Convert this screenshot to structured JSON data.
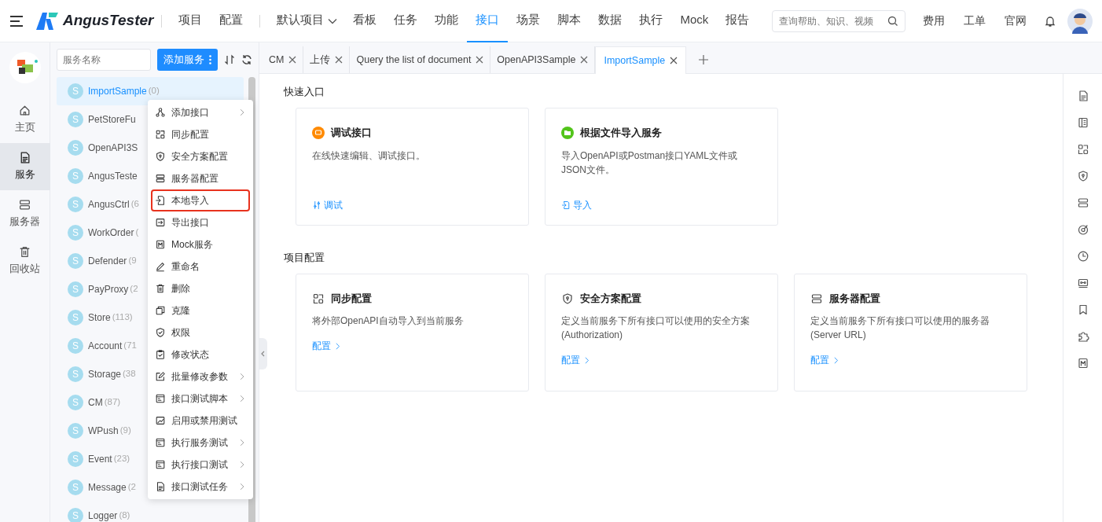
{
  "header": {
    "brand": "AngusTester",
    "nav": [
      {
        "label": "项目",
        "selected": false,
        "dropdown": false,
        "sep_before": false
      },
      {
        "label": "配置",
        "selected": false,
        "dropdown": false,
        "sep_before": false
      },
      {
        "label": "默认项目",
        "selected": false,
        "dropdown": true,
        "sep_before": true
      },
      {
        "label": "看板",
        "selected": false,
        "dropdown": false,
        "sep_before": false
      },
      {
        "label": "任务",
        "selected": false,
        "dropdown": false,
        "sep_before": false
      },
      {
        "label": "功能",
        "selected": false,
        "dropdown": false,
        "sep_before": false
      },
      {
        "label": "接口",
        "selected": true,
        "dropdown": false,
        "sep_before": false
      },
      {
        "label": "场景",
        "selected": false,
        "dropdown": false,
        "sep_before": false
      },
      {
        "label": "脚本",
        "selected": false,
        "dropdown": false,
        "sep_before": false
      },
      {
        "label": "数据",
        "selected": false,
        "dropdown": false,
        "sep_before": false
      },
      {
        "label": "执行",
        "selected": false,
        "dropdown": false,
        "sep_before": false
      },
      {
        "label": "Mock",
        "selected": false,
        "dropdown": false,
        "sep_before": false
      },
      {
        "label": "报告",
        "selected": false,
        "dropdown": false,
        "sep_before": false
      }
    ],
    "search": {
      "placeholder": "查询帮助、知识、视频"
    },
    "links": [
      "费用",
      "工单",
      "官网"
    ]
  },
  "rail": {
    "items": [
      {
        "kind": "home",
        "label": "主页",
        "selected": false
      },
      {
        "kind": "doc",
        "label": "服务",
        "selected": true
      },
      {
        "kind": "server",
        "label": "服务器",
        "selected": false
      },
      {
        "kind": "trash",
        "label": "回收站",
        "selected": false
      }
    ]
  },
  "services": {
    "search": {
      "placeholder": "服务名称"
    },
    "add_button": "添加服务",
    "items": [
      {
        "avatar": "S",
        "name": "ImportSample",
        "count": "(0)",
        "selected": true
      },
      {
        "avatar": "S",
        "name": "PetStoreFu",
        "selected": false
      },
      {
        "avatar": "S",
        "name": "OpenAPI3S",
        "selected": false
      },
      {
        "avatar": "S",
        "name": "AngusTeste",
        "selected": false
      },
      {
        "avatar": "S",
        "name": "AngusCtrl",
        "count": "(6",
        "selected": false
      },
      {
        "avatar": "S",
        "name": "WorkOrder",
        "count": "(",
        "selected": false
      },
      {
        "avatar": "S",
        "name": "Defender",
        "count": "(9",
        "selected": false
      },
      {
        "avatar": "S",
        "name": "PayProxy",
        "count": "(2",
        "selected": false
      },
      {
        "avatar": "S",
        "name": "Store",
        "count": "(113)",
        "selected": false
      },
      {
        "avatar": "S",
        "name": "Account",
        "count": "(71",
        "selected": false
      },
      {
        "avatar": "S",
        "name": "Storage",
        "count": "(38",
        "selected": false
      },
      {
        "avatar": "S",
        "name": "CM",
        "count": "(87)",
        "selected": false
      },
      {
        "avatar": "S",
        "name": "WPush",
        "count": "(9)",
        "selected": false
      },
      {
        "avatar": "S",
        "name": "Event",
        "count": "(23)",
        "selected": false
      },
      {
        "avatar": "S",
        "name": "Message",
        "count": "(2",
        "selected": false
      },
      {
        "avatar": "S",
        "name": "Logger",
        "count": "(8)",
        "selected": false
      }
    ]
  },
  "context_menu": {
    "items": [
      {
        "kind": "nodes",
        "label": "添加接口",
        "submenu": true,
        "highlighted": false
      },
      {
        "kind": "sync",
        "label": "同步配置",
        "submenu": false,
        "highlighted": false
      },
      {
        "kind": "shield",
        "label": "安全方案配置",
        "submenu": false,
        "highlighted": false
      },
      {
        "kind": "server",
        "label": "服务器配置",
        "submenu": false,
        "highlighted": false
      },
      {
        "kind": "import",
        "label": "本地导入",
        "submenu": false,
        "highlighted": true
      },
      {
        "kind": "export",
        "label": "导出接口",
        "submenu": false,
        "highlighted": false
      },
      {
        "kind": "mock",
        "label": "Mock服务",
        "submenu": false,
        "highlighted": false
      },
      {
        "kind": "pencil",
        "label": "重命名",
        "submenu": false,
        "highlighted": false
      },
      {
        "kind": "trash",
        "label": "删除",
        "submenu": false,
        "highlighted": false
      },
      {
        "kind": "copy",
        "label": "克隆",
        "submenu": false,
        "highlighted": false
      },
      {
        "kind": "shieldcheck",
        "label": "权限",
        "submenu": false,
        "highlighted": false
      },
      {
        "kind": "clipboard",
        "label": "修改状态",
        "submenu": false,
        "highlighted": false
      },
      {
        "kind": "edit",
        "label": "批量修改参数",
        "submenu": true,
        "highlighted": false
      },
      {
        "kind": "window",
        "label": "接口测试脚本",
        "submenu": true,
        "highlighted": false
      },
      {
        "kind": "chart",
        "label": "启用或禁用测试",
        "submenu": false,
        "highlighted": false
      },
      {
        "kind": "window",
        "label": "执行服务测试",
        "submenu": true,
        "highlighted": false
      },
      {
        "kind": "window",
        "label": "执行接口测试",
        "submenu": true,
        "highlighted": false
      },
      {
        "kind": "doc",
        "label": "接口测试任务",
        "submenu": true,
        "highlighted": false
      }
    ]
  },
  "tabs": [
    {
      "label": "CM",
      "selected": false
    },
    {
      "label": "上传",
      "selected": false
    },
    {
      "label": "Query the list of document",
      "selected": false
    },
    {
      "label": "OpenAPI3Sample",
      "selected": false
    },
    {
      "label": "ImportSample",
      "selected": true
    }
  ],
  "sections": [
    {
      "title": "快速入口",
      "cards": [
        {
          "kind": "debug",
          "color": "#ff8a00",
          "title": "调试接口",
          "description": "在线快速编辑、调试接口。",
          "action": "调试"
        },
        {
          "kind": "import",
          "color": "#52c41a",
          "title": "根据文件导入服务",
          "description": "导入OpenAPI或Postman接口YAML文件或JSON文件。",
          "action": "导入"
        }
      ]
    },
    {
      "title": "项目配置",
      "cards": [
        {
          "kind": "sync",
          "title": "同步配置",
          "description": "将外部OpenAPI自动导入到当前服务",
          "action": "配置"
        },
        {
          "kind": "shield",
          "title": "安全方案配置",
          "description": "定义当前服务下所有接口可以使用的安全方案(Authorization)",
          "action": "配置"
        },
        {
          "kind": "server",
          "title": "服务器配置",
          "description": "定义当前服务下所有接口可以使用的服务器(Server URL)",
          "action": "配置"
        }
      ]
    }
  ]
}
